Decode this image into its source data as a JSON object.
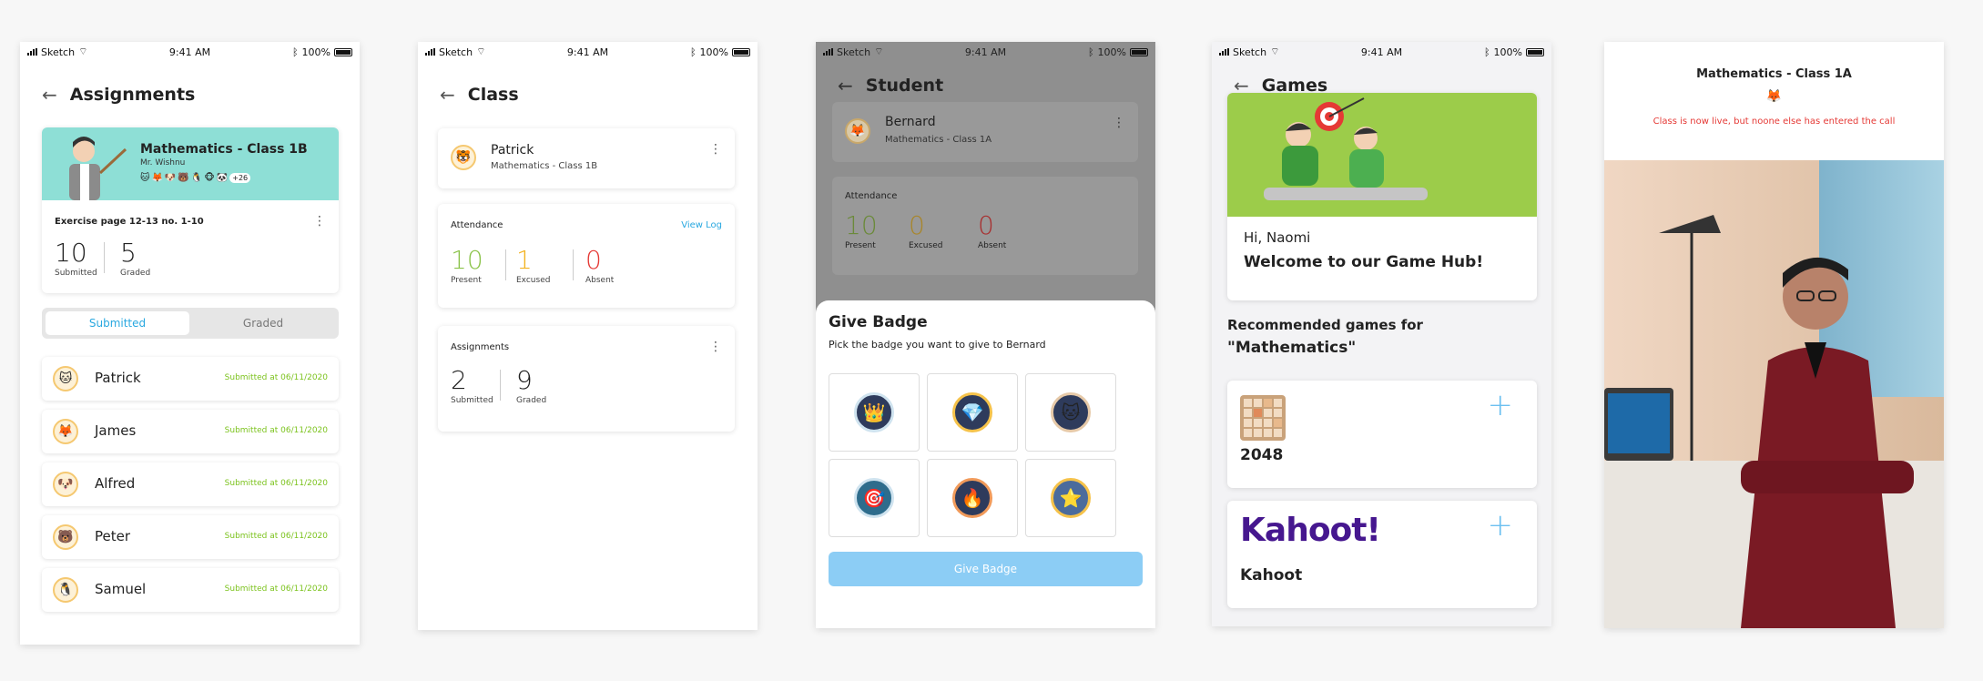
{
  "status": {
    "carrier": "Sketch",
    "time": "9:41 AM",
    "battery": "100%"
  },
  "screen1": {
    "title": "Assignments",
    "hero": {
      "class_name": "Mathematics - Class 1B",
      "teacher": "Mr. Wishnu",
      "more_count": "+26",
      "avatars": [
        "🐱",
        "🦊",
        "🐶",
        "🐻",
        "🐧",
        "🐵",
        "🐼"
      ]
    },
    "exercise": {
      "title": "Exercise page 12-13 no. 1-10",
      "submitted_value": "10",
      "submitted_label": "Submitted",
      "graded_value": "5",
      "graded_label": "Graded"
    },
    "tabs": {
      "submitted": "Submitted",
      "graded": "Graded"
    },
    "students": [
      {
        "name": "Patrick",
        "status": "Submitted at 06/11/2020",
        "icon": "🐱"
      },
      {
        "name": "James",
        "status": "Submitted at 06/11/2020",
        "icon": "🦊"
      },
      {
        "name": "Alfred",
        "status": "Submitted at 06/11/2020",
        "icon": "🐶"
      },
      {
        "name": "Peter",
        "status": "Submitted at 06/11/2020",
        "icon": "🐻"
      },
      {
        "name": "Samuel",
        "status": "Submitted at 06/11/2020",
        "icon": "🐧"
      }
    ]
  },
  "screen2": {
    "title": "Class",
    "student": {
      "name": "Patrick",
      "class": "Mathematics - Class 1B",
      "icon": "🐯"
    },
    "attendance": {
      "title": "Attendance",
      "view_log": "View Log",
      "present": "10",
      "present_label": "Present",
      "excused": "1",
      "excused_label": "Excused",
      "absent": "0",
      "absent_label": "Absent"
    },
    "assignments": {
      "title": "Assignments",
      "submitted": "2",
      "submitted_label": "Submitted",
      "graded": "9",
      "graded_label": "Graded"
    }
  },
  "screen3": {
    "title": "Student",
    "student": {
      "name": "Bernard",
      "class": "Mathematics - Class 1A",
      "icon": "🦊"
    },
    "attendance": {
      "title": "Attendance",
      "present": "10",
      "present_label": "Present",
      "excused": "0",
      "excused_label": "Excused",
      "absent": "0",
      "absent_label": "Absent"
    },
    "sheet": {
      "title": "Give Badge",
      "subtitle": "Pick the badge you want to give to Bernard",
      "button": "Give Badge"
    },
    "badges": [
      "👑",
      "💎",
      "🐱",
      "🎯",
      "🔥",
      "⭐"
    ]
  },
  "screen4": {
    "title": "Games",
    "greeting": "Hi, Naomi",
    "welcome": "Welcome to our Game Hub!",
    "recommended_prefix": "Recommended games for",
    "subject": "\"Mathematics\"",
    "games": [
      {
        "name": "2048"
      },
      {
        "name": "Kahoot",
        "logo": "Kahoot!"
      }
    ]
  },
  "screen5": {
    "title": "Mathematics - Class 1A",
    "notice": "Class is now live, but noone else has entered the call",
    "icon": "🦊"
  },
  "colors": {
    "accent": "#29a8e0",
    "green": "#8bc34a",
    "yellow": "#f3b21f",
    "red": "#e53935",
    "hero_bg": "#8edfd6",
    "kahoot": "#46178f"
  }
}
